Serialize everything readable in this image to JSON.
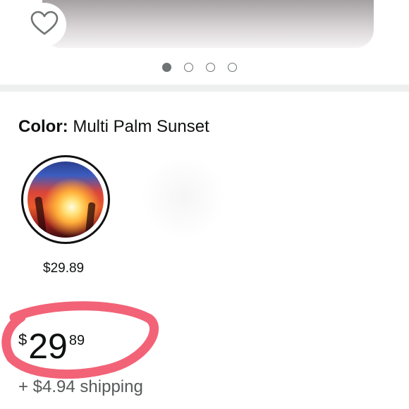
{
  "carousel": {
    "total_images": 4,
    "active_index": 0
  },
  "icons": {
    "wishlist": "heart-outline-icon"
  },
  "variation": {
    "label": "Color:",
    "selected_value": "Multi Palm Sunset",
    "options": [
      {
        "name": "Multi Palm Sunset",
        "price": "$29.89",
        "selected": true
      }
    ]
  },
  "price": {
    "symbol": "$",
    "whole": "29",
    "fraction": "89"
  },
  "shipping": {
    "text": "+ $4.94 shipping"
  },
  "colors": {
    "text": "#0f1111",
    "secondary_text": "#565959",
    "annotation_marker": "#f0485f",
    "divider": "#eef0f0"
  }
}
